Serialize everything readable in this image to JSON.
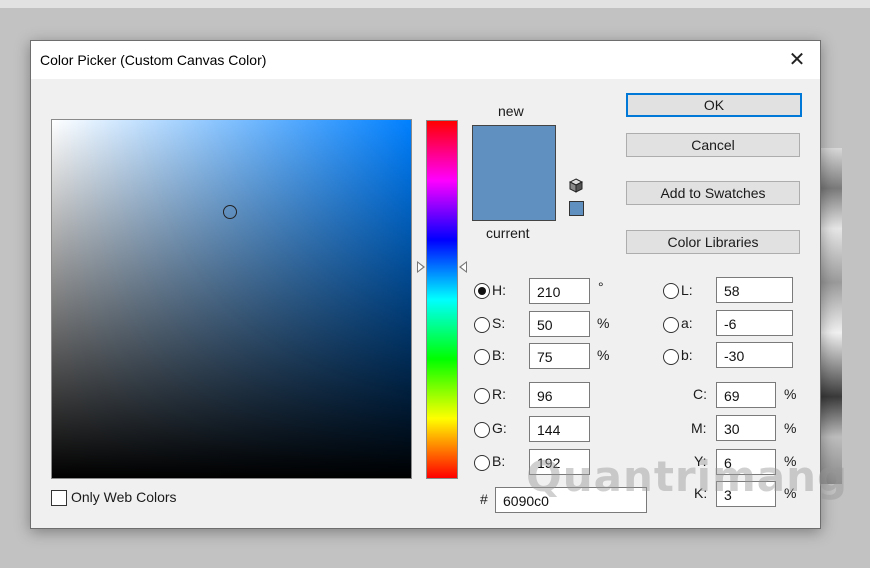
{
  "window": {
    "title": "Color Picker (Custom Canvas Color)",
    "close_glyph": "✕"
  },
  "preview": {
    "new_label": "new",
    "current_label": "current",
    "new_color": "#6090c0",
    "current_color": "#6090c0"
  },
  "buttons": {
    "ok": "OK",
    "cancel": "Cancel",
    "add_to_swatches": "Add to Swatches",
    "color_libraries": "Color Libraries"
  },
  "hsb": {
    "h": {
      "label": "H:",
      "value": "210",
      "unit": "°"
    },
    "s": {
      "label": "S:",
      "value": "50",
      "unit": "%"
    },
    "b": {
      "label": "B:",
      "value": "75",
      "unit": "%"
    }
  },
  "rgb": {
    "r": {
      "label": "R:",
      "value": "96"
    },
    "g": {
      "label": "G:",
      "value": "144"
    },
    "b": {
      "label": "B:",
      "value": "192"
    }
  },
  "lab": {
    "l": {
      "label": "L:",
      "value": "58"
    },
    "a": {
      "label": "a:",
      "value": "-6"
    },
    "b": {
      "label": "b:",
      "value": "-30"
    }
  },
  "cmyk": {
    "c": {
      "label": "C:",
      "value": "69",
      "unit": "%"
    },
    "m": {
      "label": "M:",
      "value": "30",
      "unit": "%"
    },
    "y": {
      "label": "Y:",
      "value": "6",
      "unit": "%"
    },
    "k": {
      "label": "K:",
      "value": "3",
      "unit": "%"
    }
  },
  "hex": {
    "label": "#",
    "value": "6090c0"
  },
  "only_web_colors": {
    "label": "Only Web Colors",
    "checked": false
  },
  "watermark": {
    "text": "Quantrimang"
  },
  "icons": {
    "gamut_warning": "cube-icon",
    "web_safe": "websafe-swatch-icon"
  }
}
